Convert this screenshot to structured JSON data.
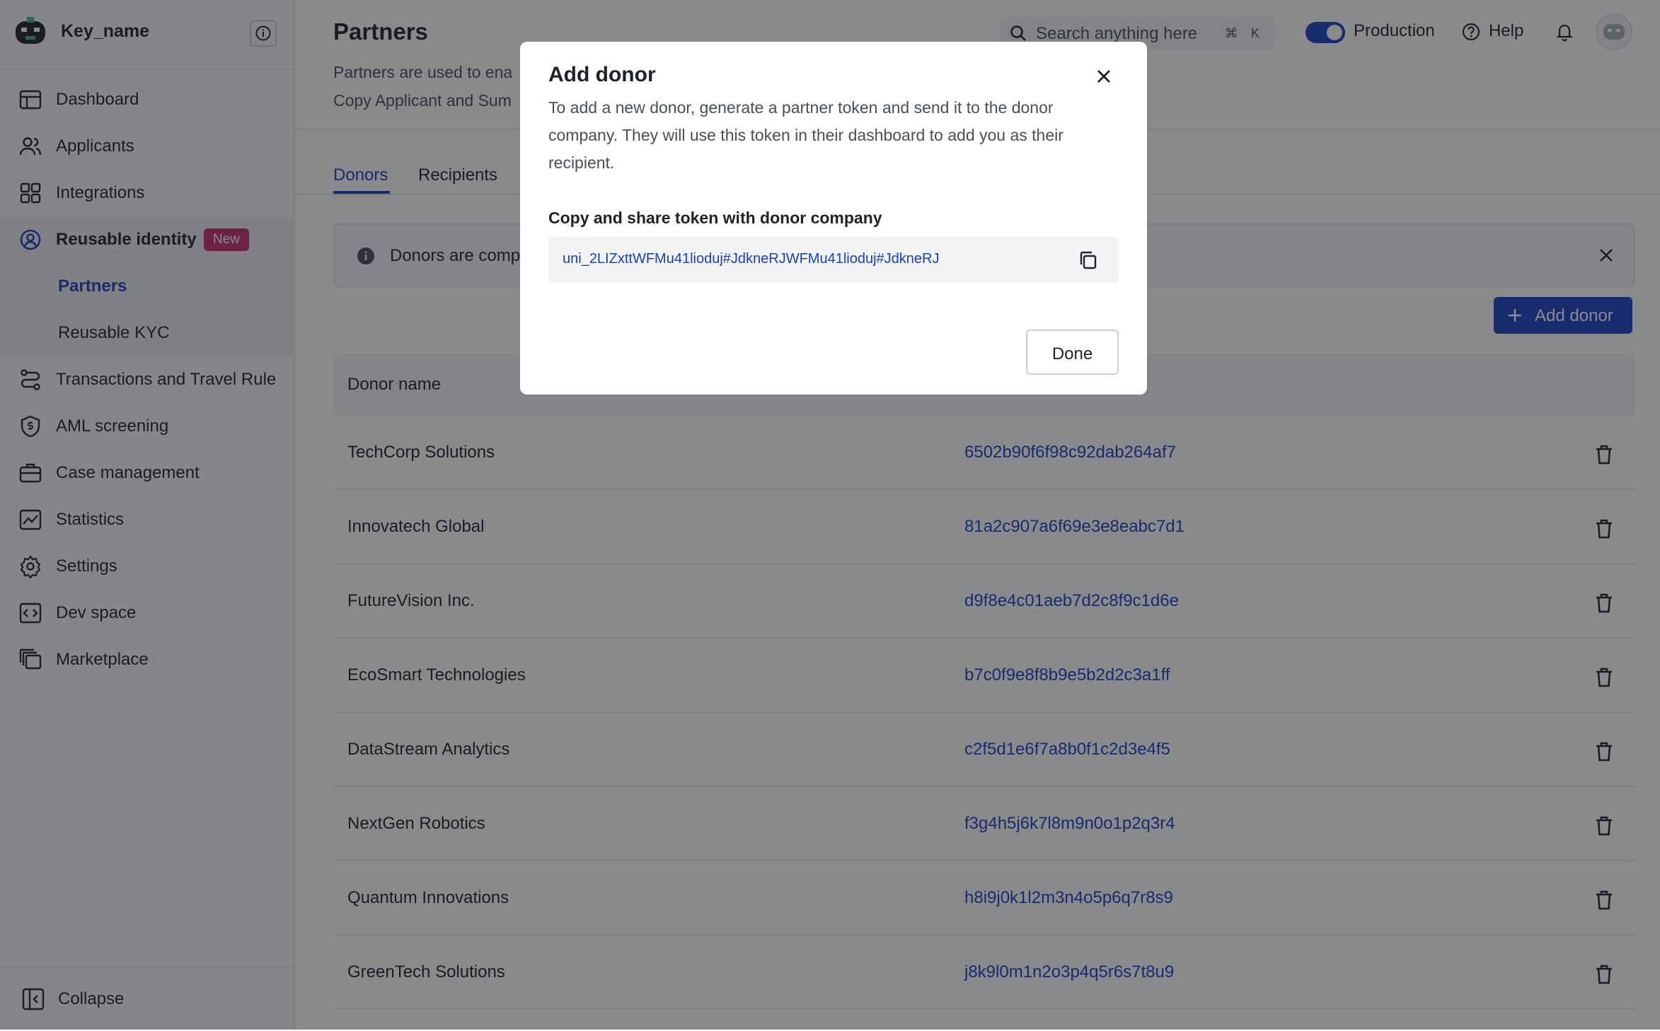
{
  "sidebar": {
    "account_name": "Key_name",
    "nav": [
      {
        "label": "Dashboard",
        "icon": "dashboard-icon"
      },
      {
        "label": "Applicants",
        "icon": "users-icon"
      },
      {
        "label": "Integrations",
        "icon": "grid-icon"
      },
      {
        "label": "Reusable identity",
        "icon": "identity-icon",
        "badge": "New",
        "active": true
      },
      {
        "label": "Partners",
        "sub": true,
        "active": true
      },
      {
        "label": "Reusable KYC",
        "sub": true
      },
      {
        "label": "Transactions and Travel Rule",
        "icon": "route-icon"
      },
      {
        "label": "AML screening",
        "icon": "shield-dollar-icon"
      },
      {
        "label": "Case management",
        "icon": "briefcase-icon"
      },
      {
        "label": "Statistics",
        "icon": "chart-icon"
      },
      {
        "label": "Settings",
        "icon": "gear-icon"
      },
      {
        "label": "Dev space",
        "icon": "code-icon"
      },
      {
        "label": "Marketplace",
        "icon": "stack-icon"
      }
    ],
    "collapse_label": "Collapse"
  },
  "header": {
    "title": "Partners",
    "description": "Partners are used to ena\nCopy Applicant and Sum",
    "search_placeholder": "Search anything here",
    "shortcut_cmd": "⌘",
    "shortcut_key": "K",
    "environment": "Production",
    "help_label": "Help"
  },
  "tabs": [
    {
      "label": "Donors",
      "active": true
    },
    {
      "label": "Recipients",
      "active": false
    }
  ],
  "banner": {
    "text": "Donors are comp"
  },
  "add_button": {
    "label": "Add donor"
  },
  "table": {
    "columns": [
      "Donor name"
    ],
    "rows": [
      {
        "name": "TechCorp Solutions",
        "id": "6502b90f6f98c92dab264af7"
      },
      {
        "name": "Innovatech Global",
        "id": "81a2c907a6f69e3e8eabc7d1"
      },
      {
        "name": "FutureVision Inc.",
        "id": "d9f8e4c01aeb7d2c8f9c1d6e"
      },
      {
        "name": "EcoSmart Technologies",
        "id": "b7c0f9e8f8b9e5b2d2c3a1ff"
      },
      {
        "name": "DataStream Analytics",
        "id": "c2f5d1e6f7a8b0f1c2d3e4f5"
      },
      {
        "name": "NextGen Robotics",
        "id": "f3g4h5j6k7l8m9n0o1p2q3r4"
      },
      {
        "name": "Quantum Innovations",
        "id": "h8i9j0k1l2m3n4o5p6q7r8s9"
      },
      {
        "name": "GreenTech Solutions",
        "id": "j8k9l0m1n2o3p4q5r6s7t8u9"
      }
    ]
  },
  "modal": {
    "title": "Add donor",
    "description": "To add a new donor, generate a partner token and send it to the donor company. They will use this token in their dashboard to add you as their recipient.",
    "token_label": "Copy and share token with donor company",
    "token": "uni_2LIZxttWFMu41lioduj#JdkneRJWFMu41lioduj#JdkneRJ",
    "done_label": "Done"
  },
  "colors": {
    "accent": "#1a40c2",
    "badge": "#c62d6f"
  }
}
